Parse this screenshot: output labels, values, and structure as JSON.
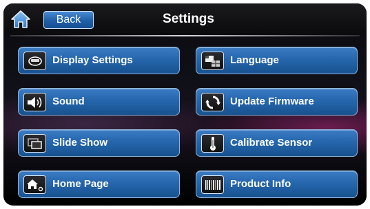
{
  "header": {
    "back_label": "Back",
    "title": "Settings"
  },
  "menu": [
    {
      "label": "Display Settings",
      "icon": "display-icon"
    },
    {
      "label": "Language",
      "icon": "language-flags-icon"
    },
    {
      "label": "Sound",
      "icon": "speaker-icon"
    },
    {
      "label": "Update Firmware",
      "icon": "refresh-icon"
    },
    {
      "label": "Slide Show",
      "icon": "slideshow-icon"
    },
    {
      "label": "Calibrate Sensor",
      "icon": "thermometer-icon"
    },
    {
      "label": "Home Page",
      "icon": "home-page-icon"
    },
    {
      "label": "Product Info",
      "icon": "barcode-icon"
    }
  ],
  "colors": {
    "button_blue": "#2566ad",
    "accent_border": "#8fb4da"
  }
}
